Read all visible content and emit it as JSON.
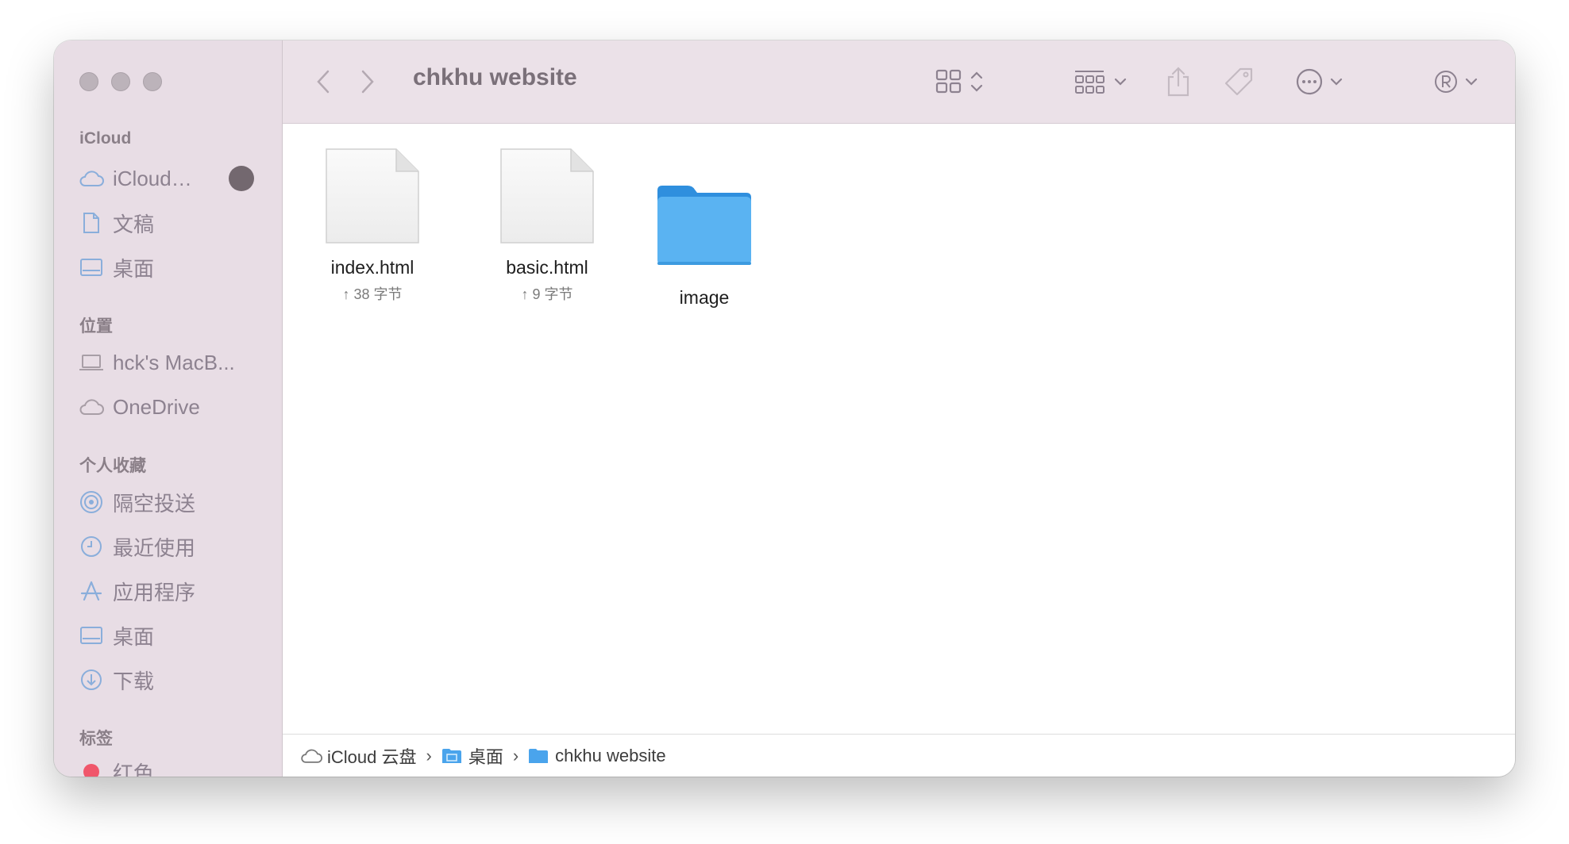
{
  "window": {
    "title": "chkhu website"
  },
  "sidebar": {
    "sections": {
      "icloud": "iCloud",
      "locations": "位置",
      "favorites": "个人收藏",
      "tags": "标签"
    },
    "icloud_items": [
      {
        "label": "iCloud…",
        "icon": "cloud-icon"
      },
      {
        "label": "文稿",
        "icon": "document-icon"
      },
      {
        "label": "桌面",
        "icon": "desktop-icon"
      }
    ],
    "location_items": [
      {
        "label": "hck's MacB...",
        "icon": "laptop-icon"
      },
      {
        "label": "OneDrive",
        "icon": "cloud-icon"
      }
    ],
    "favorite_items": [
      {
        "label": "隔空投送",
        "icon": "airdrop-icon"
      },
      {
        "label": "最近使用",
        "icon": "clock-icon"
      },
      {
        "label": "应用程序",
        "icon": "apps-icon"
      },
      {
        "label": "桌面",
        "icon": "desktop-icon"
      },
      {
        "label": "下载",
        "icon": "download-icon"
      }
    ],
    "tag_items": [
      {
        "label": "红色",
        "color": "#f0566b"
      }
    ]
  },
  "files": [
    {
      "name": "index.html",
      "size": "↑ 38 字节",
      "kind": "document"
    },
    {
      "name": "basic.html",
      "size": "↑ 9 字节",
      "kind": "document"
    },
    {
      "name": "image",
      "size": "",
      "kind": "folder"
    }
  ],
  "pathbar": {
    "segments": [
      {
        "label": "iCloud 云盘",
        "icon": "cloud-icon"
      },
      {
        "label": "桌面",
        "icon": "folder-icon"
      },
      {
        "label": "chkhu website",
        "icon": "folder-icon"
      }
    ],
    "separator": "›"
  },
  "colors": {
    "sidebar_bg": "#e8dde5",
    "toolbar_bg": "#ebe1e8",
    "folder_blue": "#5ab3f2",
    "tag_red": "#f0566b",
    "sidebar_icon": "#8aaedb"
  }
}
